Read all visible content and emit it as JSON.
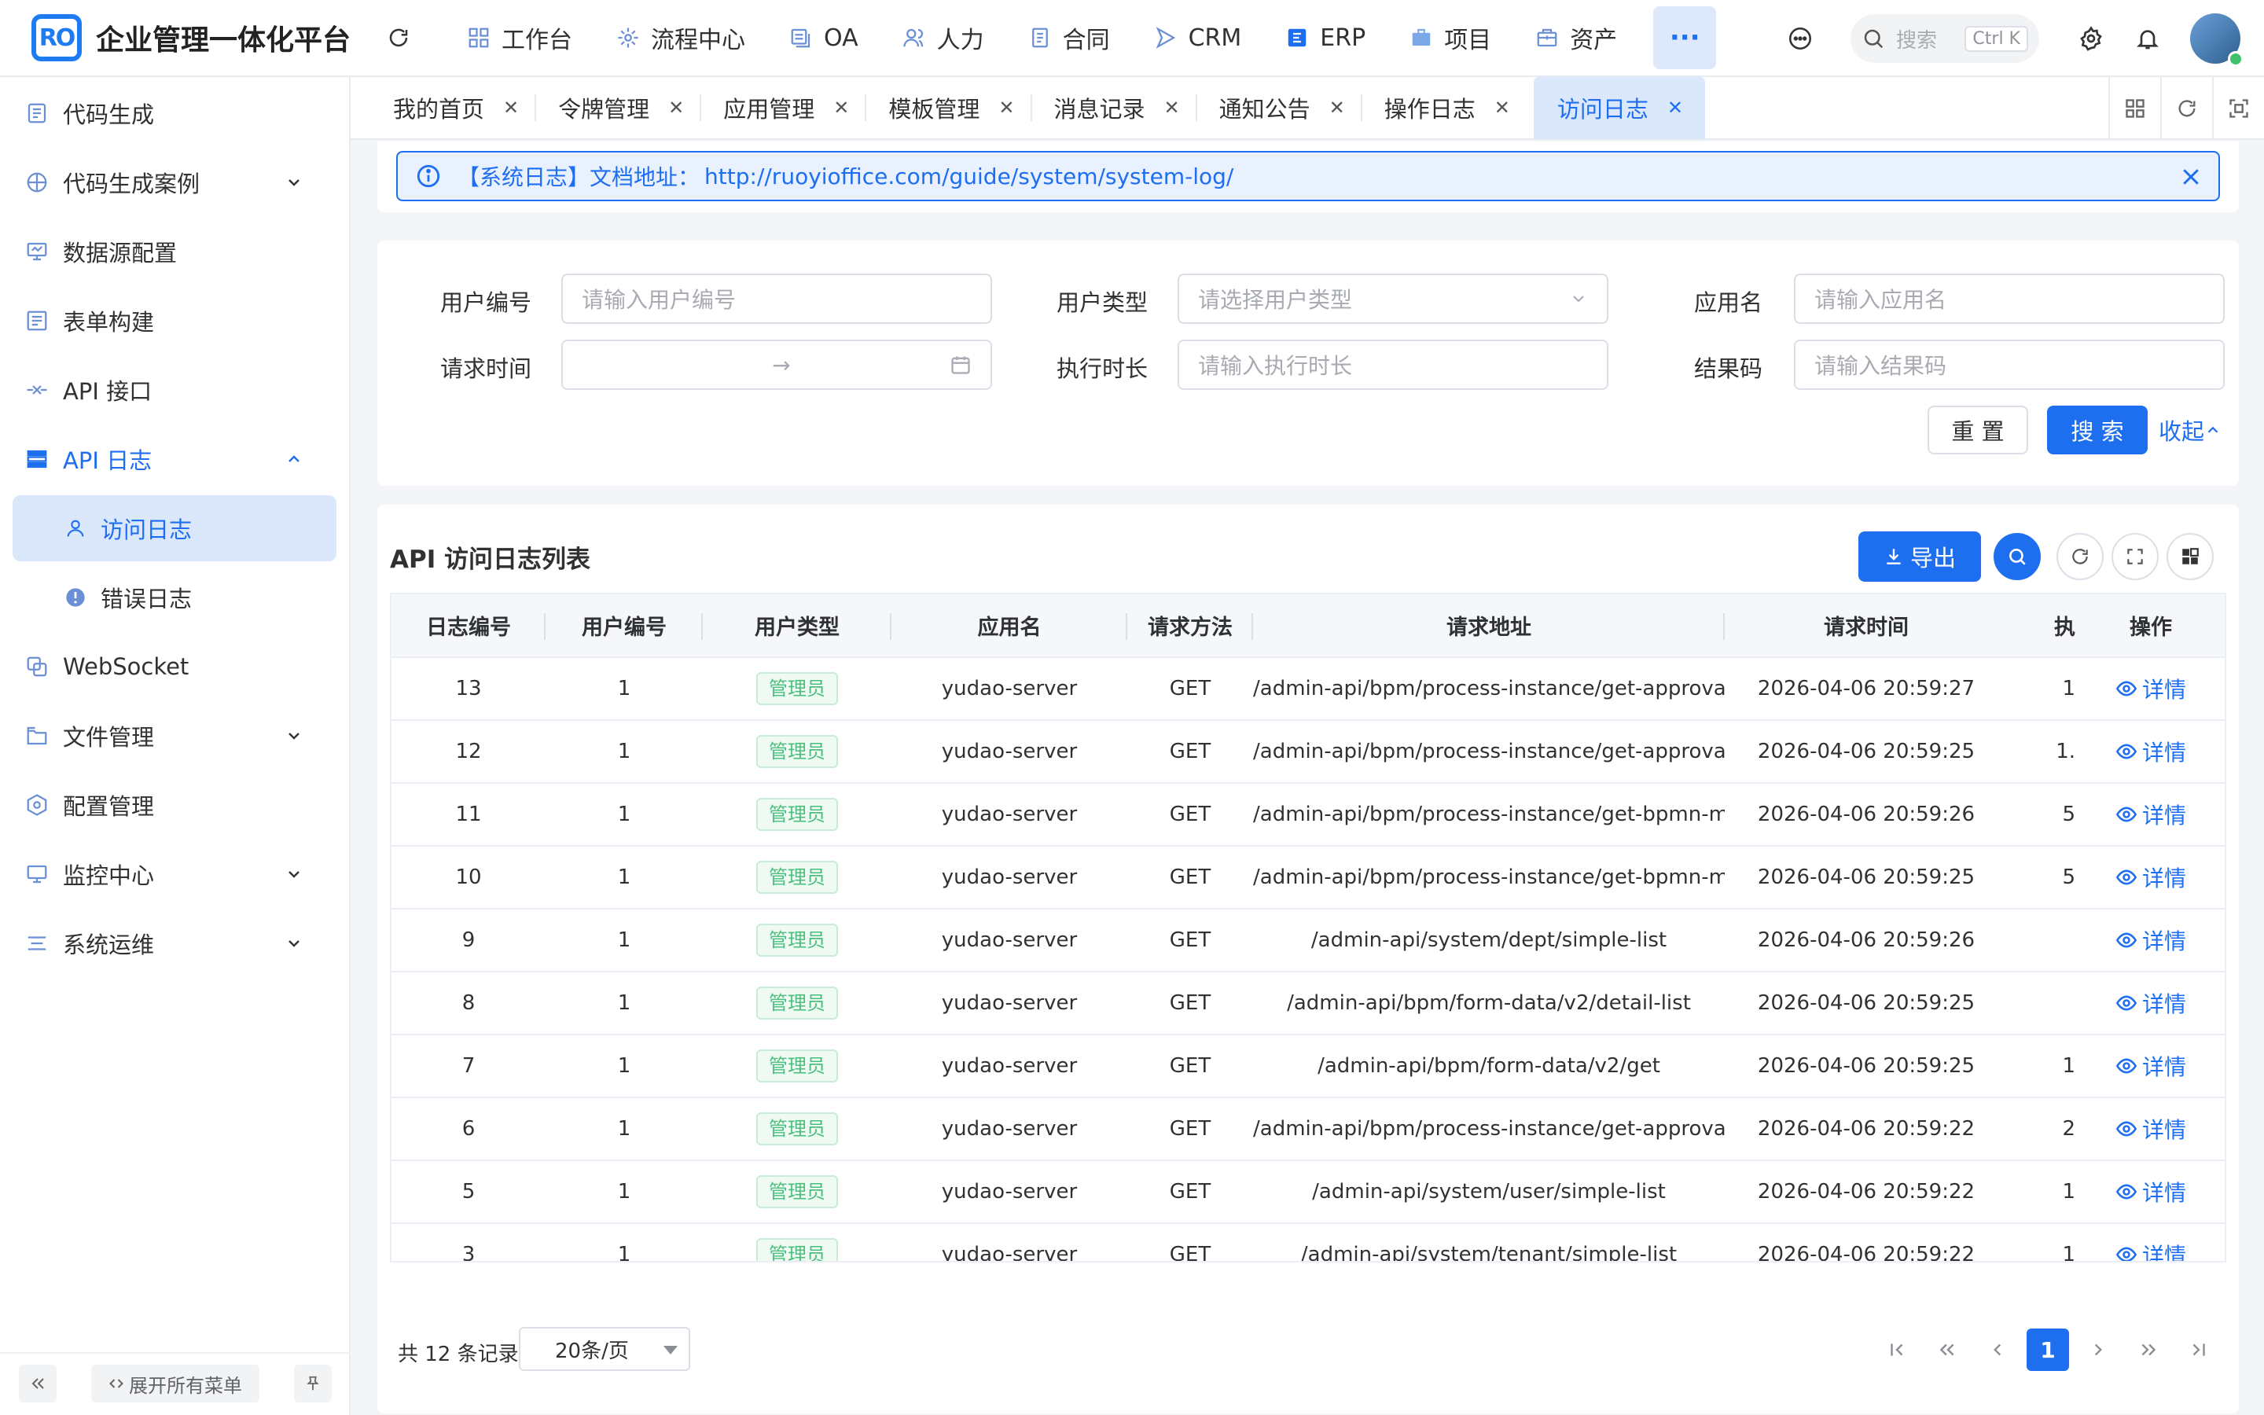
{
  "header": {
    "app_title": "企业管理一体化平台",
    "logo_text": "RO",
    "nav": [
      {
        "label": "工作台",
        "icon": "dashboard-icon"
      },
      {
        "label": "流程中心",
        "icon": "workflow-icon"
      },
      {
        "label": "OA",
        "icon": "oa-icon"
      },
      {
        "label": "人力",
        "icon": "people-icon"
      },
      {
        "label": "合同",
        "icon": "contract-icon"
      },
      {
        "label": "CRM",
        "icon": "crm-icon"
      },
      {
        "label": "ERP",
        "icon": "erp-icon"
      },
      {
        "label": "项目",
        "icon": "project-icon"
      },
      {
        "label": "资产",
        "icon": "asset-icon"
      }
    ],
    "more_label": "···",
    "search_placeholder": "搜索",
    "search_shortcut": "Ctrl K"
  },
  "sidebar": {
    "items": [
      {
        "label": "代码生成",
        "icon": "code-icon"
      },
      {
        "label": "代码生成案例",
        "icon": "example-icon",
        "expandable": true
      },
      {
        "label": "数据源配置",
        "icon": "datasource-icon"
      },
      {
        "label": "表单构建",
        "icon": "form-icon"
      },
      {
        "label": "API 接口",
        "icon": "api-icon"
      },
      {
        "label": "API 日志",
        "icon": "log-icon",
        "expanded": true
      },
      {
        "label": "WebSocket",
        "icon": "websocket-icon"
      },
      {
        "label": "文件管理",
        "icon": "folder-icon",
        "expandable": true
      },
      {
        "label": "配置管理",
        "icon": "config-icon"
      },
      {
        "label": "监控中心",
        "icon": "monitor-icon",
        "expandable": true
      },
      {
        "label": "系统运维",
        "icon": "ops-icon",
        "expandable": true
      }
    ],
    "sub_items": [
      {
        "label": "访问日志",
        "active": true
      },
      {
        "label": "错误日志"
      }
    ],
    "expand_all_label": "展开所有菜单"
  },
  "tabs": [
    {
      "label": "我的首页"
    },
    {
      "label": "令牌管理"
    },
    {
      "label": "应用管理"
    },
    {
      "label": "模板管理"
    },
    {
      "label": "消息记录"
    },
    {
      "label": "通知公告"
    },
    {
      "label": "操作日志"
    },
    {
      "label": "访问日志",
      "active": true
    }
  ],
  "alert": {
    "prefix": "【系统日志】",
    "text": "文档地址：",
    "link": "http://ruoyioffice.com/guide/system/system-log/"
  },
  "form": {
    "user_id_label": "用户编号",
    "user_id_placeholder": "请输入用户编号",
    "user_type_label": "用户类型",
    "user_type_placeholder": "请选择用户类型",
    "app_name_label": "应用名",
    "app_name_placeholder": "请输入应用名",
    "request_time_label": "请求时间",
    "range_sep": "→",
    "duration_label": "执行时长",
    "duration_placeholder": "请输入执行时长",
    "result_code_label": "结果码",
    "result_code_placeholder": "请输入结果码",
    "reset_label": "重 置",
    "search_label": "搜 索",
    "collapse_label": "收起"
  },
  "table": {
    "title": "API 访问日志列表",
    "export_label": "导出",
    "columns": [
      "日志编号",
      "用户编号",
      "用户类型",
      "应用名",
      "请求方法",
      "请求地址",
      "请求时间",
      "执",
      "操作"
    ],
    "rows": [
      {
        "id": "13",
        "user_id": "1",
        "user_type": "管理员",
        "app": "yudao-server",
        "method": "GET",
        "url": "/admin-api/bpm/process-instance/get-approval...",
        "time": "2026-04-06 20:59:27",
        "duration": "1",
        "action": "详情"
      },
      {
        "id": "12",
        "user_id": "1",
        "user_type": "管理员",
        "app": "yudao-server",
        "method": "GET",
        "url": "/admin-api/bpm/process-instance/get-approval...",
        "time": "2026-04-06 20:59:25",
        "duration": "1.",
        "action": "详情"
      },
      {
        "id": "11",
        "user_id": "1",
        "user_type": "管理员",
        "app": "yudao-server",
        "method": "GET",
        "url": "/admin-api/bpm/process-instance/get-bpmn-m...",
        "time": "2026-04-06 20:59:26",
        "duration": "5",
        "action": "详情"
      },
      {
        "id": "10",
        "user_id": "1",
        "user_type": "管理员",
        "app": "yudao-server",
        "method": "GET",
        "url": "/admin-api/bpm/process-instance/get-bpmn-m...",
        "time": "2026-04-06 20:59:25",
        "duration": "5",
        "action": "详情"
      },
      {
        "id": "9",
        "user_id": "1",
        "user_type": "管理员",
        "app": "yudao-server",
        "method": "GET",
        "url": "/admin-api/system/dept/simple-list",
        "time": "2026-04-06 20:59:26",
        "duration": "",
        "action": "详情"
      },
      {
        "id": "8",
        "user_id": "1",
        "user_type": "管理员",
        "app": "yudao-server",
        "method": "GET",
        "url": "/admin-api/bpm/form-data/v2/detail-list",
        "time": "2026-04-06 20:59:25",
        "duration": "",
        "action": "详情"
      },
      {
        "id": "7",
        "user_id": "1",
        "user_type": "管理员",
        "app": "yudao-server",
        "method": "GET",
        "url": "/admin-api/bpm/form-data/v2/get",
        "time": "2026-04-06 20:59:25",
        "duration": "1",
        "action": "详情"
      },
      {
        "id": "6",
        "user_id": "1",
        "user_type": "管理员",
        "app": "yudao-server",
        "method": "GET",
        "url": "/admin-api/bpm/process-instance/get-approval...",
        "time": "2026-04-06 20:59:22",
        "duration": "2",
        "action": "详情"
      },
      {
        "id": "5",
        "user_id": "1",
        "user_type": "管理员",
        "app": "yudao-server",
        "method": "GET",
        "url": "/admin-api/system/user/simple-list",
        "time": "2026-04-06 20:59:22",
        "duration": "1",
        "action": "详情"
      },
      {
        "id": "3",
        "user_id": "1",
        "user_type": "管理员",
        "app": "yudao-server",
        "method": "GET",
        "url": "/admin-api/system/tenant/simple-list",
        "time": "2026-04-06 20:59:22",
        "duration": "1",
        "action": "详情"
      }
    ]
  },
  "pagination": {
    "total_text": "共 12 条记录",
    "page_size": "20条/页",
    "current_page": "1"
  },
  "colors": {
    "primary": "#1e6ef0",
    "tag_green": "#4cbf7e",
    "active_bg": "#dbe8fc"
  }
}
